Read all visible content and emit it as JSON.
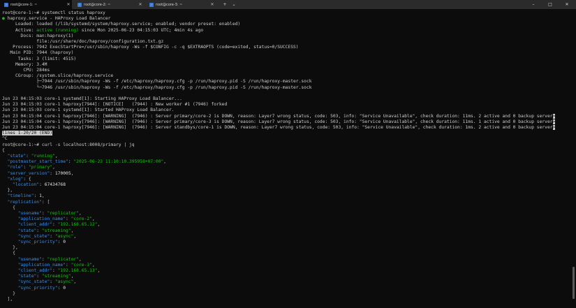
{
  "tabs": [
    {
      "label": "root@core-1: ~",
      "active": true
    },
    {
      "label": "root@core-2: ~",
      "active": false
    },
    {
      "label": "root@core-3: ~",
      "active": false
    }
  ],
  "toolbar": {
    "new_tab": "+",
    "dropdown": "⌄"
  },
  "window": {
    "minimize": "–",
    "maximize": "□",
    "close": "✕"
  },
  "colors": {
    "background": "#0c0c0c",
    "green": "#16c60c",
    "blue": "#3b8eea",
    "text": "#cccccc"
  },
  "terminal": {
    "lines": [
      [
        {
          "t": "root@core-1:~# systemctl status haproxy"
        }
      ],
      [
        {
          "t": "●",
          "c": "g"
        },
        {
          "t": " haproxy.service - HAProxy Load Balancer"
        }
      ],
      [
        {
          "t": "     Loaded: loaded (/lib/systemd/system/haproxy.service; enabled; vendor preset: enabled)"
        }
      ],
      [
        {
          "t": "     Active: "
        },
        {
          "t": "active (running)",
          "c": "g"
        },
        {
          "t": " since Mon 2025-06-23 04:15:03 UTC; 4min 4s ago"
        }
      ],
      [
        {
          "t": "       Docs: man:haproxy(1)"
        }
      ],
      [
        {
          "t": "             file:/usr/share/doc/haproxy/configuration.txt.gz"
        }
      ],
      [
        {
          "t": "    Process: 7942 ExecStartPre=/usr/sbin/haproxy -Ws -f $CONFIG -c -q $EXTRAOPTS (code=exited, status=0/SUCCESS)"
        }
      ],
      [
        {
          "t": "   Main PID: 7944 (haproxy)"
        }
      ],
      [
        {
          "t": "      Tasks: 3 (limit: 4515)"
        }
      ],
      [
        {
          "t": "     Memory: 3.4M"
        }
      ],
      [
        {
          "t": "        CPU: 284ms"
        }
      ],
      [
        {
          "t": "     CGroup: /system.slice/haproxy.service"
        }
      ],
      [
        {
          "t": "             ├─7944 /usr/sbin/haproxy -Ws -f /etc/haproxy/haproxy.cfg -p /run/haproxy.pid -S /run/haproxy-master.sock"
        }
      ],
      [
        {
          "t": "             └─7946 /usr/sbin/haproxy -Ws -f /etc/haproxy/haproxy.cfg -p /run/haproxy.pid -S /run/haproxy-master.sock"
        }
      ],
      [
        {
          "t": ""
        }
      ],
      [
        {
          "t": "Jun 23 04:15:03 core-1 systemd[1]: Starting HAProxy Load Balancer..."
        }
      ],
      [
        {
          "t": "Jun 23 04:15:03 core-1 haproxy[7944]: [NOTICE]   (7944) : New worker #1 (7946) forked"
        }
      ],
      [
        {
          "t": "Jun 23 04:15:03 core-1 systemd[1]: Started HAProxy Load Balancer."
        }
      ],
      [
        {
          "t": "Jun 23 04:15:04 core-1 haproxy[7946]: [WARNING]  (7946) : Server primary/core-2 is DOWN, reason: Layer7 wrong status, code: 503, info: \"Service Unavailable\", check duration: 11ms. 2 active and 0 backup server"
        },
        {
          "t": ">",
          "c": "hl"
        }
      ],
      [
        {
          "t": "Jun 23 04:15:04 core-1 haproxy[7946]: [WARNING]  (7946) : Server primary/core-3 is DOWN, reason: Layer7 wrong status, code: 503, info: \"Service Unavailable\", check duration: 11ms. 1 active and 0 backup server"
        },
        {
          "t": ">",
          "c": "hl"
        }
      ],
      [
        {
          "t": "Jun 23 04:15:04 core-1 haproxy[7946]: [WARNING]  (7946) : Server standbys/core-1 is DOWN, reason: Layer7 wrong status, code: 503, info: \"Service Unavailable\", check duration: 1ms. 2 active and 0 backup server"
        },
        {
          "t": ">",
          "c": "hl"
        }
      ],
      [
        {
          "t": "lines 1-20/20 (END)",
          "c": "hl"
        }
      ],
      [
        {
          "t": "^C"
        }
      ],
      [
        {
          "t": "root@core-1:~# curl -s localhost:8008/primary | jq"
        }
      ],
      [
        {
          "t": "{"
        }
      ],
      [
        {
          "t": "  "
        },
        {
          "t": "\"state\"",
          "c": "key"
        },
        {
          "t": ": "
        },
        {
          "t": "\"running\"",
          "c": "str"
        },
        {
          "t": ","
        }
      ],
      [
        {
          "t": "  "
        },
        {
          "t": "\"postmaster_start_time\"",
          "c": "key"
        },
        {
          "t": ": "
        },
        {
          "t": "\"2025-06-23 11:10:10.395958+07:00\"",
          "c": "str"
        },
        {
          "t": ","
        }
      ],
      [
        {
          "t": "  "
        },
        {
          "t": "\"role\"",
          "c": "key"
        },
        {
          "t": ": "
        },
        {
          "t": "\"primary\"",
          "c": "str"
        },
        {
          "t": ","
        }
      ],
      [
        {
          "t": "  "
        },
        {
          "t": "\"server_version\"",
          "c": "key"
        },
        {
          "t": ": "
        },
        {
          "t": "170005",
          "c": "num"
        },
        {
          "t": ","
        }
      ],
      [
        {
          "t": "  "
        },
        {
          "t": "\"xlog\"",
          "c": "key"
        },
        {
          "t": ": {"
        }
      ],
      [
        {
          "t": "    "
        },
        {
          "t": "\"location\"",
          "c": "key"
        },
        {
          "t": ": "
        },
        {
          "t": "67434768",
          "c": "num"
        }
      ],
      [
        {
          "t": "  },"
        }
      ],
      [
        {
          "t": "  "
        },
        {
          "t": "\"timeline\"",
          "c": "key"
        },
        {
          "t": ": "
        },
        {
          "t": "1",
          "c": "num"
        },
        {
          "t": ","
        }
      ],
      [
        {
          "t": "  "
        },
        {
          "t": "\"replication\"",
          "c": "key"
        },
        {
          "t": ": ["
        }
      ],
      [
        {
          "t": "    {"
        }
      ],
      [
        {
          "t": "      "
        },
        {
          "t": "\"usename\"",
          "c": "key"
        },
        {
          "t": ": "
        },
        {
          "t": "\"replicator\"",
          "c": "str"
        },
        {
          "t": ","
        }
      ],
      [
        {
          "t": "      "
        },
        {
          "t": "\"application_name\"",
          "c": "key"
        },
        {
          "t": ": "
        },
        {
          "t": "\"core-2\"",
          "c": "str"
        },
        {
          "t": ","
        }
      ],
      [
        {
          "t": "      "
        },
        {
          "t": "\"client_addr\"",
          "c": "key"
        },
        {
          "t": ": "
        },
        {
          "t": "\"192.168.65.12\"",
          "c": "str"
        },
        {
          "t": ","
        }
      ],
      [
        {
          "t": "      "
        },
        {
          "t": "\"state\"",
          "c": "key"
        },
        {
          "t": ": "
        },
        {
          "t": "\"streaming\"",
          "c": "str"
        },
        {
          "t": ","
        }
      ],
      [
        {
          "t": "      "
        },
        {
          "t": "\"sync_state\"",
          "c": "key"
        },
        {
          "t": ": "
        },
        {
          "t": "\"async\"",
          "c": "str"
        },
        {
          "t": ","
        }
      ],
      [
        {
          "t": "      "
        },
        {
          "t": "\"sync_priority\"",
          "c": "key"
        },
        {
          "t": ": "
        },
        {
          "t": "0",
          "c": "num"
        }
      ],
      [
        {
          "t": "    },"
        }
      ],
      [
        {
          "t": "    {"
        }
      ],
      [
        {
          "t": "      "
        },
        {
          "t": "\"usename\"",
          "c": "key"
        },
        {
          "t": ": "
        },
        {
          "t": "\"replicator\"",
          "c": "str"
        },
        {
          "t": ","
        }
      ],
      [
        {
          "t": "      "
        },
        {
          "t": "\"application_name\"",
          "c": "key"
        },
        {
          "t": ": "
        },
        {
          "t": "\"core-3\"",
          "c": "str"
        },
        {
          "t": ","
        }
      ],
      [
        {
          "t": "      "
        },
        {
          "t": "\"client_addr\"",
          "c": "key"
        },
        {
          "t": ": "
        },
        {
          "t": "\"192.168.65.13\"",
          "c": "str"
        },
        {
          "t": ","
        }
      ],
      [
        {
          "t": "      "
        },
        {
          "t": "\"state\"",
          "c": "key"
        },
        {
          "t": ": "
        },
        {
          "t": "\"streaming\"",
          "c": "str"
        },
        {
          "t": ","
        }
      ],
      [
        {
          "t": "      "
        },
        {
          "t": "\"sync_state\"",
          "c": "key"
        },
        {
          "t": ": "
        },
        {
          "t": "\"async\"",
          "c": "str"
        },
        {
          "t": ","
        }
      ],
      [
        {
          "t": "      "
        },
        {
          "t": "\"sync_priority\"",
          "c": "key"
        },
        {
          "t": ": "
        },
        {
          "t": "0",
          "c": "num"
        }
      ],
      [
        {
          "t": "    }"
        }
      ],
      [
        {
          "t": "  ],"
        }
      ]
    ]
  }
}
